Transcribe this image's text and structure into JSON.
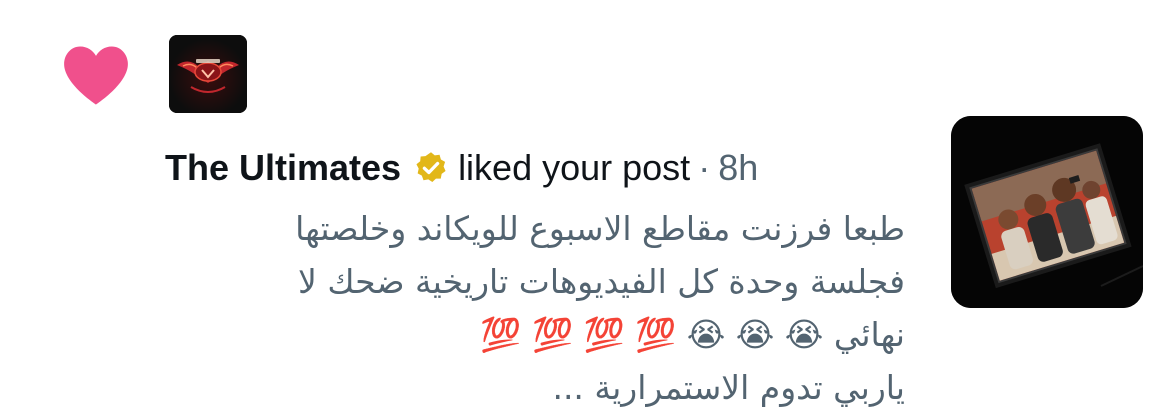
{
  "notification": {
    "type_icon": "heart-icon",
    "avatar_icon": "ultimates-logo-avatar",
    "user_name": "The Ultimates",
    "verified_badge": "gold-verified-icon",
    "action": "liked your post",
    "separator": "·",
    "time": "8h",
    "post_lines": [
      "طبعا فرزنت مقاطع الاسبوع للويكاند وخلصتها",
      "فجلسة وحدة كل الفيديوهات تاريخية ضحك لا",
      "نهائي 😭 😭 😭 💯 💯 💯 💯",
      "ياربي تدوم الاستمرارية ..."
    ],
    "thumbnail": "post-thumbnail-image"
  },
  "colors": {
    "heart": "#f0508c",
    "verified_gold": "#e2b719",
    "primary_text": "#0f1419",
    "secondary_text": "#536471"
  }
}
